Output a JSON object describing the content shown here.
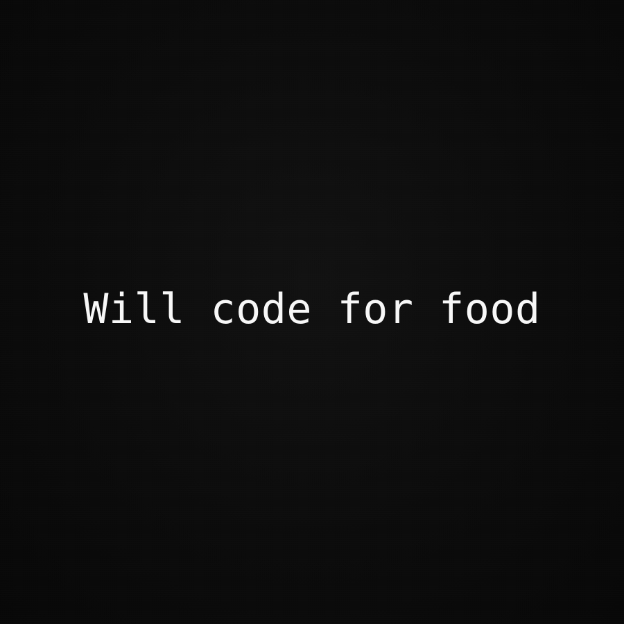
{
  "print": {
    "text": "Will code for food",
    "text_color": "#f7f7f7"
  },
  "background": {
    "color": "#0b0b0b"
  }
}
